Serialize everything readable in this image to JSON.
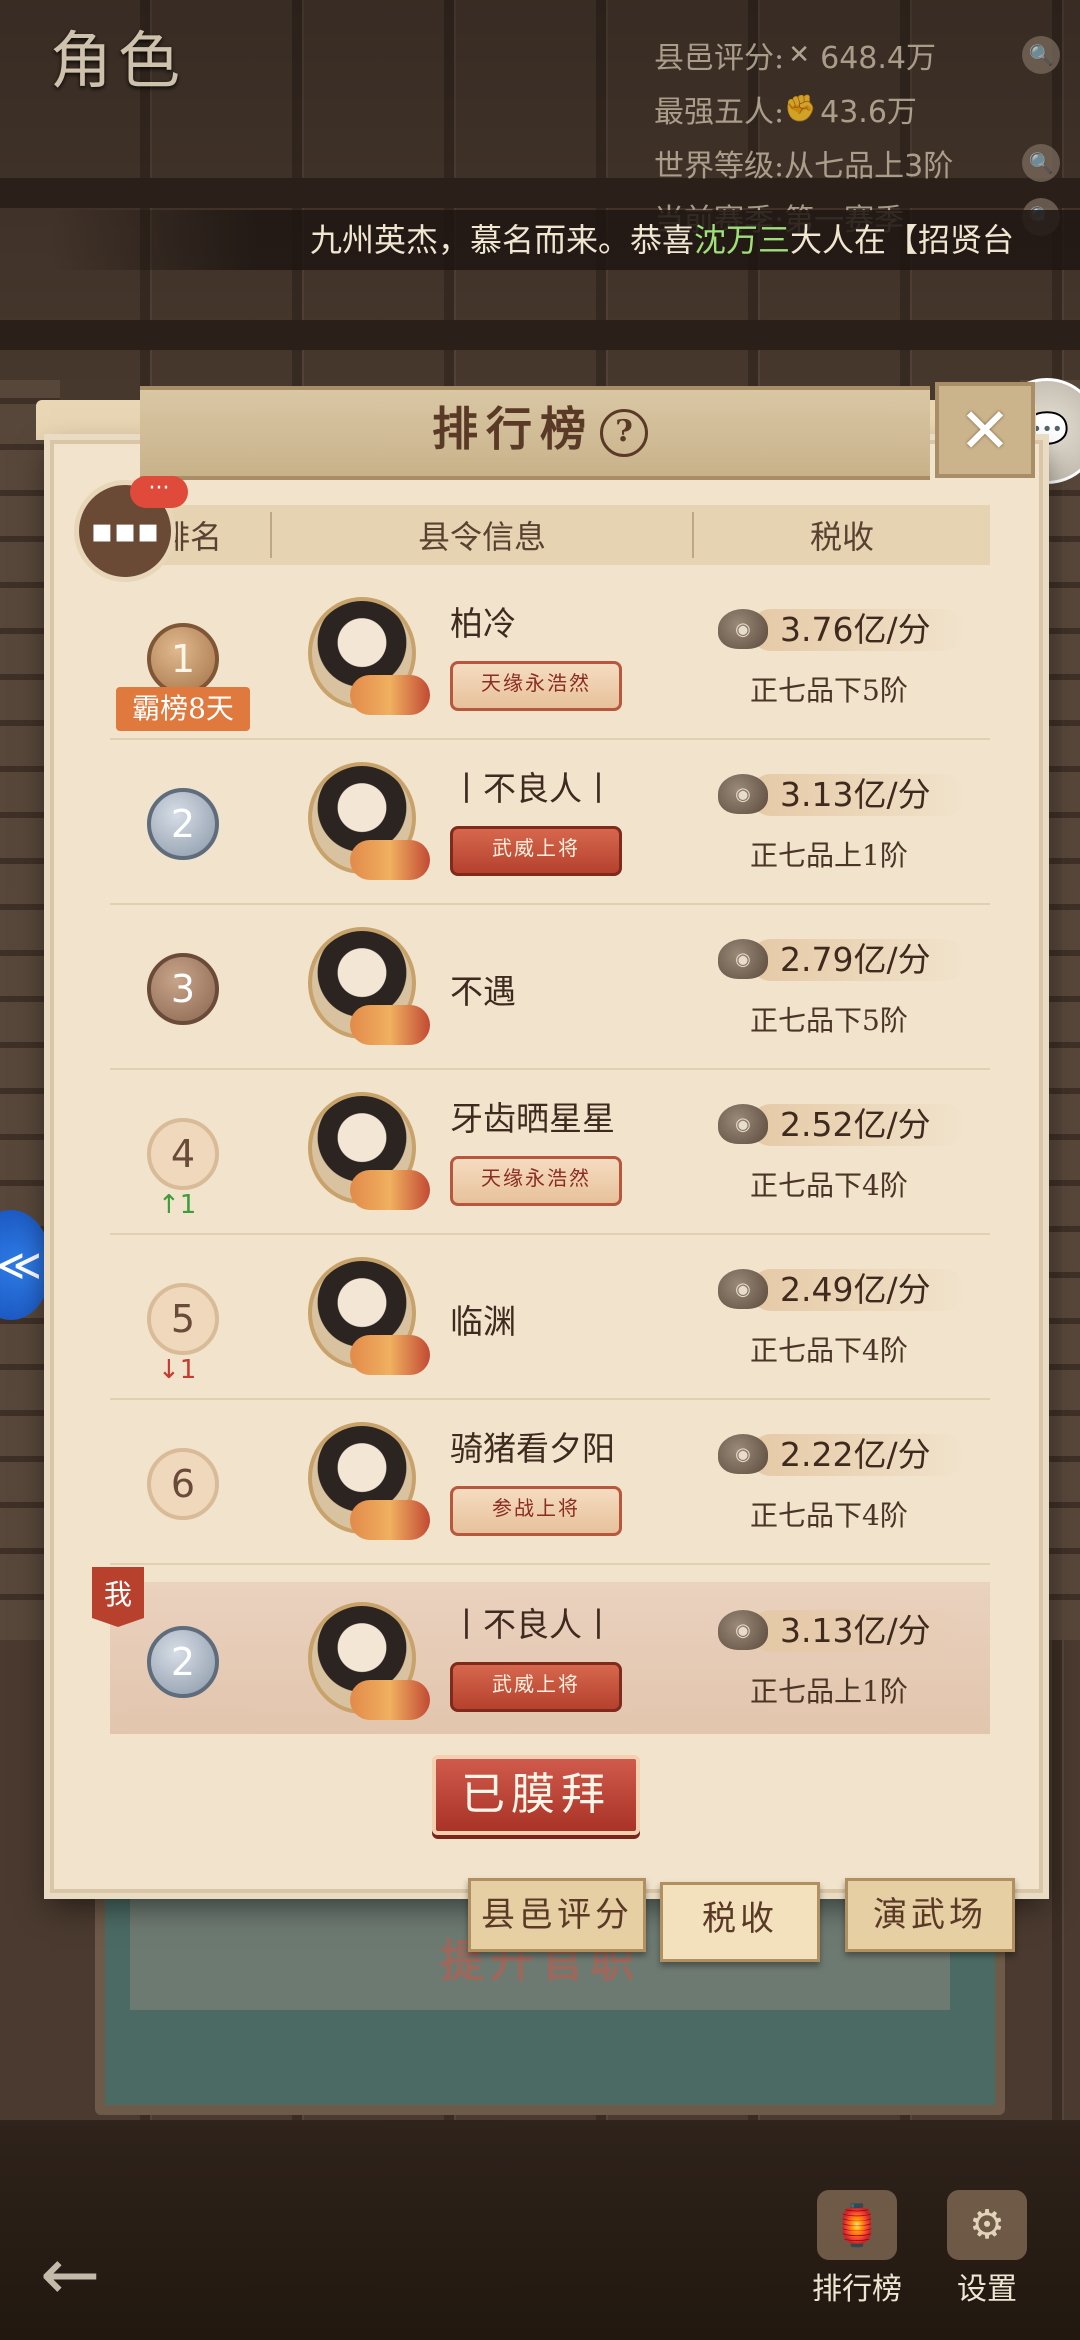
{
  "screen": {
    "role_title": "角色",
    "stats": [
      {
        "label": "县邑评分:",
        "icon": "hammer-icon",
        "value": "648.4万"
      },
      {
        "label": "最强五人:",
        "icon": "fist-icon",
        "value": "43.6万"
      },
      {
        "label": "世界等级:",
        "icon": "",
        "value": "从七品上3阶"
      },
      {
        "label": "当前赛季:",
        "icon": "",
        "value": "第一赛季"
      }
    ],
    "ticker": {
      "before": "九州英杰，慕名而来。恭喜",
      "highlight": "沈万三",
      "after": "大人在【招贤台"
    }
  },
  "panel": {
    "title": "排行榜",
    "help_glyph": "?",
    "close_glyph": "✕",
    "chat_badge": "···",
    "columns": [
      "排名",
      "县令信息",
      "税收"
    ],
    "rows": [
      {
        "rank": "1",
        "medal": "gold",
        "streak": "霸榜8天",
        "name": "柏冷",
        "badge": "天缘永浩然",
        "badge_style": "light",
        "tax": "3.76亿/分",
        "grade": "正七品下5阶"
      },
      {
        "rank": "2",
        "medal": "silver",
        "name": "丨不良人丨",
        "badge": "武威上将",
        "badge_style": "red",
        "tax": "3.13亿/分",
        "grade": "正七品上1阶"
      },
      {
        "rank": "3",
        "medal": "bronze",
        "name": "不遇",
        "tax": "2.79亿/分",
        "grade": "正七品下5阶"
      },
      {
        "rank": "4",
        "medal": "plain",
        "change": "↑1",
        "change_dir": "up",
        "name": "牙齿晒星星",
        "badge": "天缘永浩然",
        "badge_style": "light",
        "tax": "2.52亿/分",
        "grade": "正七品下4阶"
      },
      {
        "rank": "5",
        "medal": "plain",
        "change": "↓1",
        "change_dir": "down",
        "name": "临渊",
        "tax": "2.49亿/分",
        "grade": "正七品下4阶"
      },
      {
        "rank": "6",
        "medal": "plain",
        "name": "骑猪看夕阳",
        "badge": "参战上将",
        "badge_style": "light",
        "tax": "2.22亿/分",
        "grade": "正七品下4阶"
      }
    ],
    "me": {
      "tag": "我",
      "rank": "2",
      "name": "丨不良人丨",
      "badge": "武威上将",
      "tax": "3.13亿/分",
      "grade": "正七品上1阶"
    },
    "worship_button": "已膜拜",
    "tabs": [
      {
        "label": "县邑评分",
        "active": false
      },
      {
        "label": "税收",
        "active": true
      },
      {
        "label": "演武场",
        "active": false
      }
    ]
  },
  "background": {
    "board_text": "提升官职"
  },
  "bottom": {
    "back_glyph": "←",
    "buttons": [
      {
        "label": "排行榜",
        "icon": "ranking-icon"
      },
      {
        "label": "设置",
        "icon": "settings-icon"
      }
    ]
  },
  "colors": {
    "accent_red": "#b8412e",
    "ticker_highlight": "#9fe07a",
    "panel_bg": "#f1e3cc"
  }
}
